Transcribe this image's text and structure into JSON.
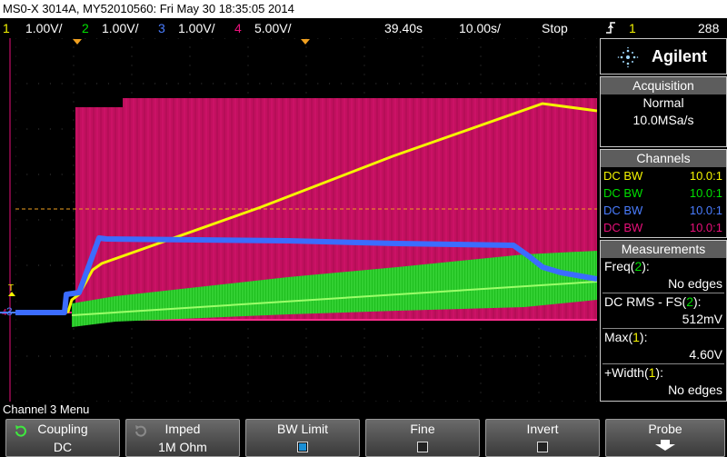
{
  "title": "MS0-X 3014A, MY52010560: Fri May 30 18:35:05 2014",
  "status": {
    "ch1": {
      "num": "1",
      "scale": "1.00V/",
      "color": "#f5f500"
    },
    "ch2": {
      "num": "2",
      "scale": "1.00V/",
      "color": "#00e000"
    },
    "ch3": {
      "num": "3",
      "scale": "1.00V/",
      "color": "#4a7dff"
    },
    "ch4": {
      "num": "4",
      "scale": "5.00V/",
      "color": "#e8107a"
    },
    "delay": "39.40s",
    "timebase": "10.00s/",
    "run_state": "Stop",
    "trig_icon": "trigger-edge-icon",
    "trig_channel": "1",
    "trig_level": "288"
  },
  "panel": {
    "brand": "Agilent",
    "acquisition": {
      "header": "Acquisition",
      "mode": "Normal",
      "rate": "10.0MSa/s"
    },
    "channels": {
      "header": "Channels",
      "rows": [
        {
          "label": "DC BW",
          "value": "10.0:1",
          "color": "#f5f500"
        },
        {
          "label": "DC BW",
          "value": "10.0:1",
          "color": "#00e000"
        },
        {
          "label": "DC BW",
          "value": "10.0:1",
          "color": "#4a7dff"
        },
        {
          "label": "DC BW",
          "value": "10.0:1",
          "color": "#e8107a"
        }
      ]
    },
    "measurements": {
      "header": "Measurements",
      "items": [
        {
          "name_pre": "Freq(",
          "ch": "2",
          "name_post": "):",
          "ch_color": "#00e000",
          "value": "No edges"
        },
        {
          "name_pre": "DC RMS - FS(",
          "ch": "2",
          "name_post": "):",
          "ch_color": "#00e000",
          "value": "512mV"
        },
        {
          "name_pre": "Max(",
          "ch": "1",
          "name_post": "):",
          "ch_color": "#f5f500",
          "value": "4.60V"
        },
        {
          "name_pre": "+Width(",
          "ch": "1",
          "name_post": "):",
          "ch_color": "#f5f500",
          "value": "No edges"
        }
      ]
    }
  },
  "markers": {
    "trigger_label": "T",
    "ch4_label": "4",
    "ch3_label": "3"
  },
  "menu": {
    "title": "Channel 3 Menu",
    "softkeys": [
      {
        "label": "Coupling",
        "value": "DC",
        "icon": "rotate-knob-icon"
      },
      {
        "label": "Imped",
        "value": "1M Ohm",
        "icon": "rotate-knob-icon"
      },
      {
        "label": "BW Limit",
        "checked": true
      },
      {
        "label": "Fine",
        "checked": false
      },
      {
        "label": "Invert",
        "checked": false
      },
      {
        "label": "Probe",
        "icon": "arrow-down-icon"
      }
    ]
  }
}
